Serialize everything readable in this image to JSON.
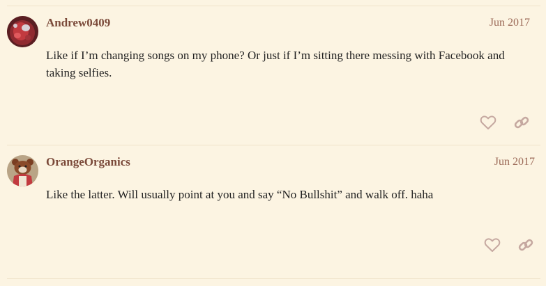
{
  "theme": {
    "background": "#fcf4e2",
    "username_color": "#7b4a3a",
    "date_color": "#9c6a58",
    "icon_color": "#c5a8a0",
    "divider_color": "#efe3ca"
  },
  "posts": [
    {
      "username": "Andrew0409",
      "date": "Jun 2017",
      "body": "Like if I’m changing songs on my phone? Or just if I’m sitting there messing with Facebook and taking selfies.",
      "avatar_icon": "red-toy-avatar",
      "like_icon": "heart-icon",
      "link_icon": "link-icon"
    },
    {
      "username": "OrangeOrganics",
      "date": "Jun 2017",
      "body": "Like the latter. Will usually point at you and say “No Bullshit” and walk off. haha",
      "avatar_icon": "cartoon-bear-avatar",
      "like_icon": "heart-icon",
      "link_icon": "link-icon"
    }
  ]
}
